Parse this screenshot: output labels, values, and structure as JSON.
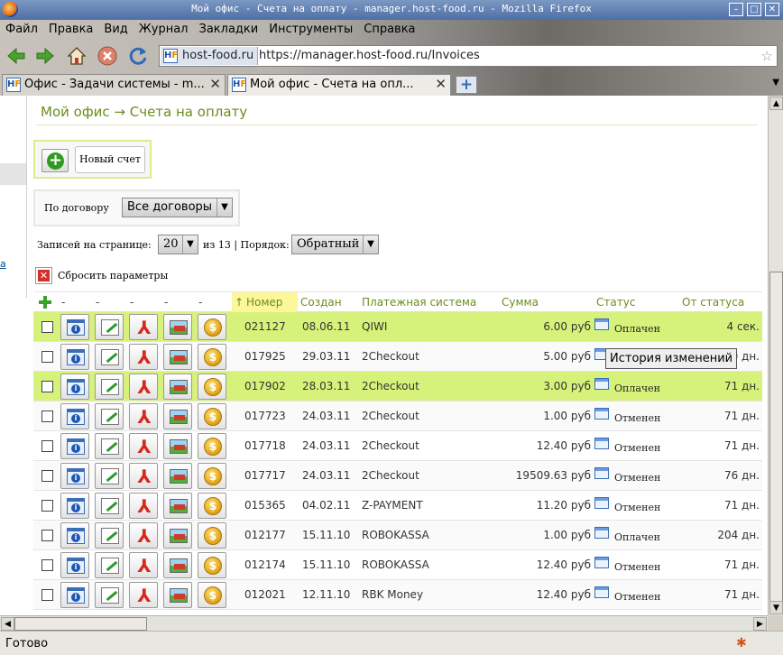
{
  "window": {
    "title": "Мой офис - Счета на оплату - manager.host-food.ru - Mozilla Firefox",
    "min_label": "–",
    "max_label": "□",
    "close_label": "✕"
  },
  "menu": [
    "Файл",
    "Правка",
    "Вид",
    "Журнал",
    "Закладки",
    "Инструменты",
    "Справка"
  ],
  "urlbar": {
    "site": "host-food.ru",
    "url": "https://manager.host-food.ru/Invoices"
  },
  "tabs": [
    {
      "label": "Офис - Задачи системы - m..."
    },
    {
      "label": "Мой офис - Счета на опл..."
    }
  ],
  "page": {
    "breadcrumb": "Мой офис → Счета на оплату",
    "new_invoice": "Новый счет",
    "contract_label": "По договору",
    "contract_value": "Все договоры",
    "per_page_label": "Записей на странице:",
    "per_page_value": "20",
    "of_pages": "из 13 | Порядок:",
    "order_value": "Обратный",
    "reset_label": "Сбросить параметры",
    "left_link": "а"
  },
  "table": {
    "headers": {
      "dashes": [
        "-",
        "-",
        "-",
        "-",
        "-"
      ],
      "number": "Номер",
      "created": "Создан",
      "system": "Платежная система",
      "sum": "Сумма",
      "status": "Статус",
      "since": "От статуса"
    },
    "rows": [
      {
        "number": "021127",
        "created": "08.06.11",
        "system": "QIWI",
        "sum": "6.00 руб",
        "status": "Оплачен",
        "since": "4 сек.",
        "highlight": true
      },
      {
        "number": "017925",
        "created": "29.03.11",
        "system": "2Checkout",
        "sum": "5.00 руб",
        "status": "",
        "since": "0 дн.",
        "highlight": false
      },
      {
        "number": "017902",
        "created": "28.03.11",
        "system": "2Checkout",
        "sum": "3.00 руб",
        "status": "Оплачен",
        "since": "71 дн.",
        "highlight": true
      },
      {
        "number": "017723",
        "created": "24.03.11",
        "system": "2Checkout",
        "sum": "1.00 руб",
        "status": "Отменен",
        "since": "71 дн.",
        "highlight": false
      },
      {
        "number": "017718",
        "created": "24.03.11",
        "system": "2Checkout",
        "sum": "12.40 руб",
        "status": "Отменен",
        "since": "71 дн.",
        "highlight": false
      },
      {
        "number": "017717",
        "created": "24.03.11",
        "system": "2Checkout",
        "sum": "19509.63 руб",
        "status": "Отменен",
        "since": "76 дн.",
        "highlight": false
      },
      {
        "number": "015365",
        "created": "04.02.11",
        "system": "Z-PAYMENT",
        "sum": "11.20 руб",
        "status": "Отменен",
        "since": "71 дн.",
        "highlight": false
      },
      {
        "number": "012177",
        "created": "15.11.10",
        "system": "ROBOKASSA",
        "sum": "1.00 руб",
        "status": "Оплачен",
        "since": "204 дн.",
        "highlight": false
      },
      {
        "number": "012174",
        "created": "15.11.10",
        "system": "ROBOKASSA",
        "sum": "12.40 руб",
        "status": "Отменен",
        "since": "71 дн.",
        "highlight": false
      },
      {
        "number": "012021",
        "created": "12.11.10",
        "system": "RBK Money",
        "sum": "12.40 руб",
        "status": "Отменен",
        "since": "71 дн.",
        "highlight": false
      }
    ]
  },
  "tooltip": "История изменений",
  "statusbar": {
    "text": "Готово"
  },
  "colors": {
    "highlight_row": "#d7f27a",
    "accent_green": "#6a8d1c"
  }
}
